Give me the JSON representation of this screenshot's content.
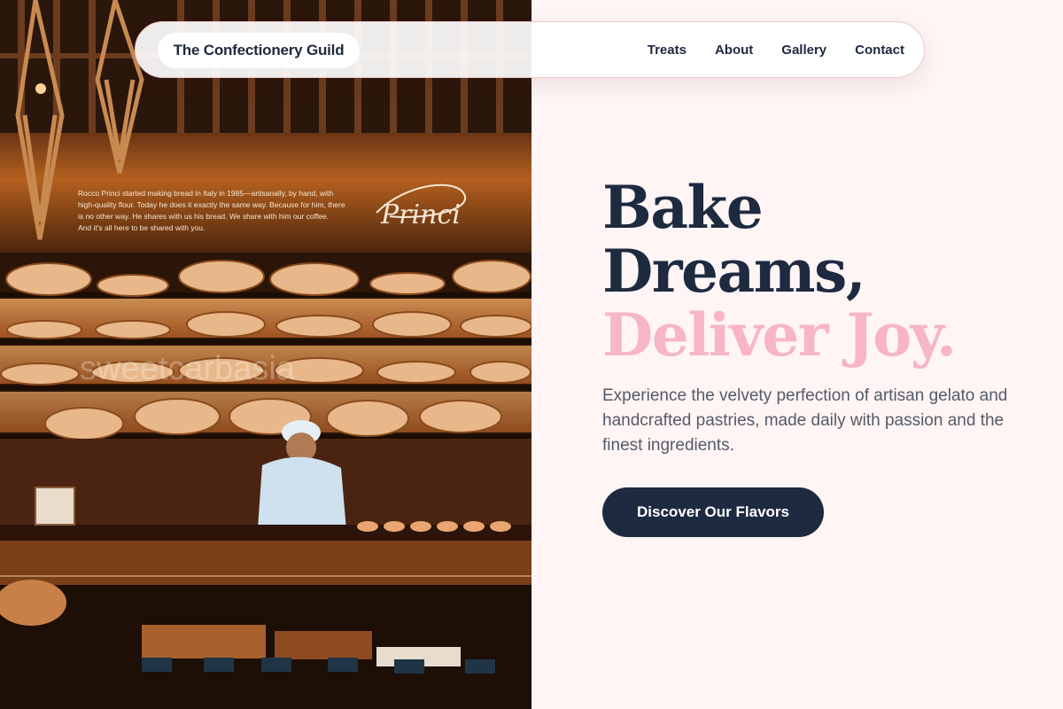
{
  "nav": {
    "brand": "The Confectionery Guild",
    "links": [
      "Treats",
      "About",
      "Gallery",
      "Contact"
    ]
  },
  "hero": {
    "headline_line1": "Bake",
    "headline_line2": "Dreams,",
    "headline_line3": "Deliver Joy.",
    "intro": "Experience the velvety perfection of artisan gelato and handcrafted pastries, made daily with passion and the finest ingredients.",
    "cta_label": "Discover Our Flavors"
  },
  "photo": {
    "wall_text": "Rocco Princi started making bread in Italy in 1985—artisanally, by hand, with high-quality flour. Today he does it exactly the same way. Because for him, there is no other way. He shares with us his bread. We share with him our coffee. And it's all here to be shared with you.",
    "signature": "Princi",
    "watermark": "sweetcarbasia"
  },
  "colors": {
    "navy": "#1e2a40",
    "pink_accent": "#f7b5c6",
    "background": "#fff5f5",
    "body_text": "#555a66"
  }
}
